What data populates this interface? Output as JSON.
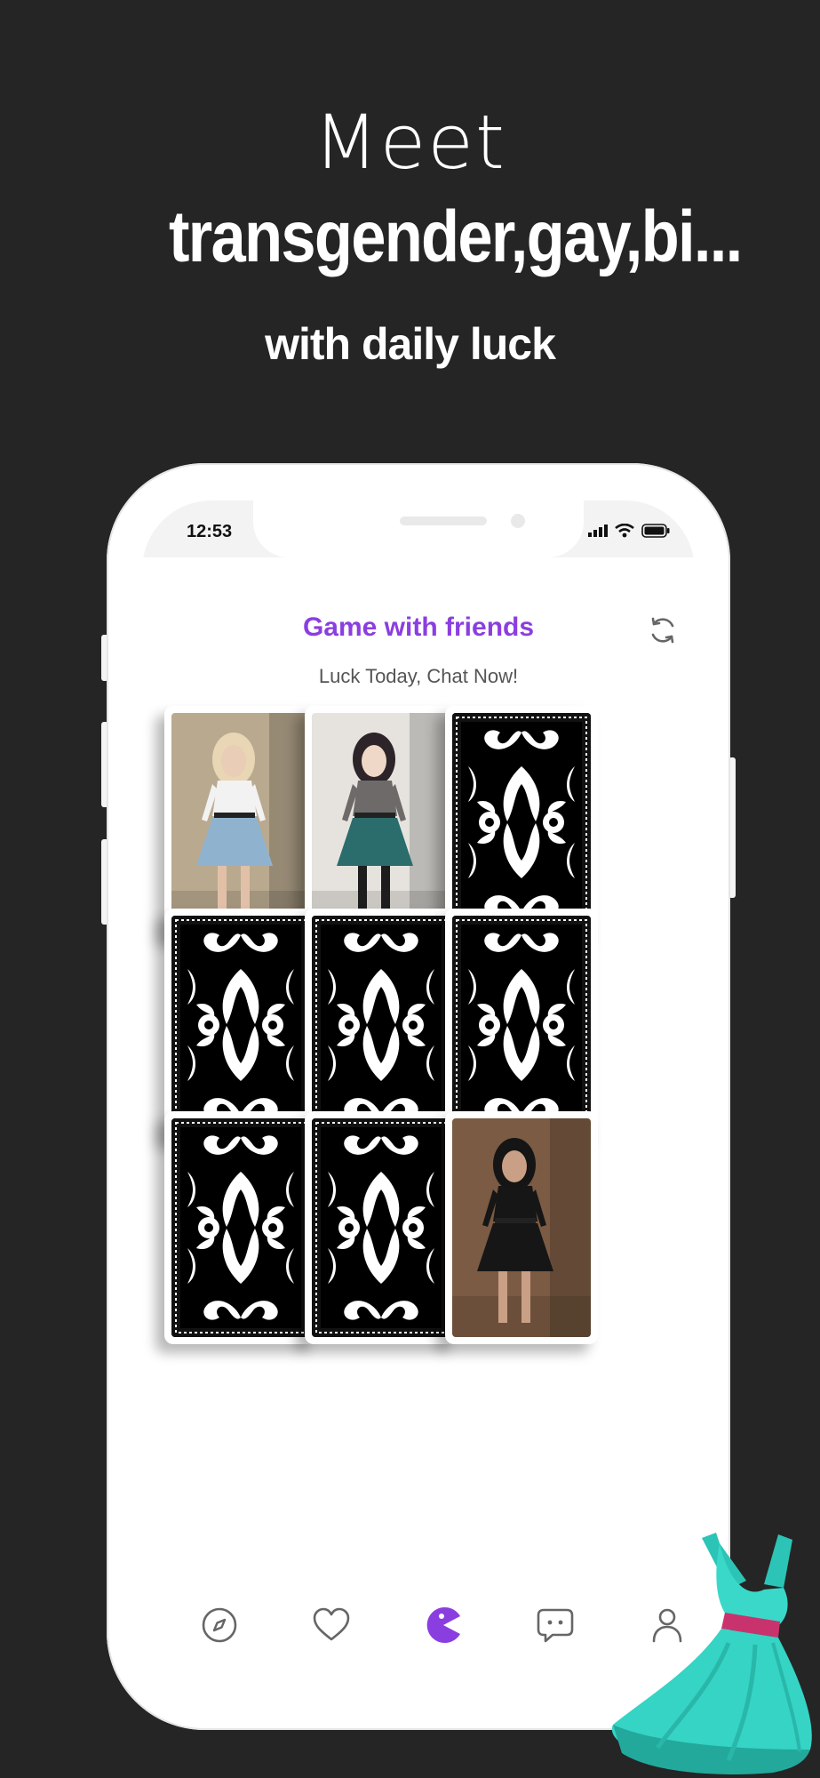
{
  "headline": {
    "line1": "Meet",
    "line2": "transgender,gay,bi...",
    "line3": "with daily luck"
  },
  "status_bar": {
    "time": "12:53",
    "icons": [
      "signal-icon",
      "wifi-icon",
      "battery-icon"
    ]
  },
  "app": {
    "title": "Game with friends",
    "subtitle": "Luck Today, Chat Now!",
    "refresh_icon": "refresh-icon"
  },
  "cards": [
    {
      "state": "revealed",
      "photo": "profile-photo-blonde-blue-dress"
    },
    {
      "state": "revealed",
      "photo": "profile-photo-dark-hair-teal-skirt"
    },
    {
      "state": "face-down"
    },
    {
      "state": "face-down"
    },
    {
      "state": "face-down"
    },
    {
      "state": "face-down"
    },
    {
      "state": "face-down"
    },
    {
      "state": "face-down"
    },
    {
      "state": "revealed",
      "photo": "profile-photo-mirror-selfie-black-dress"
    }
  ],
  "tab_bar": {
    "items": [
      {
        "name": "discover",
        "icon": "compass-icon",
        "active": false
      },
      {
        "name": "likes",
        "icon": "heart-icon",
        "active": false
      },
      {
        "name": "game",
        "icon": "pacman-icon",
        "active": true
      },
      {
        "name": "chat",
        "icon": "chat-bubble-icon",
        "active": false
      },
      {
        "name": "profile",
        "icon": "person-icon",
        "active": false
      }
    ]
  },
  "colors": {
    "background": "#252525",
    "accent": "#8b3ee0",
    "dress": "#35d4c5"
  }
}
